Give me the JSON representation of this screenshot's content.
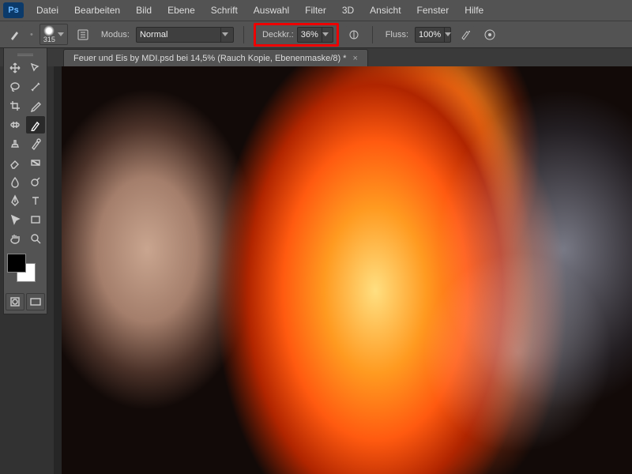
{
  "menubar": {
    "items": [
      "Datei",
      "Bearbeiten",
      "Bild",
      "Ebene",
      "Schrift",
      "Auswahl",
      "Filter",
      "3D",
      "Ansicht",
      "Fenster",
      "Hilfe"
    ]
  },
  "optbar": {
    "brush_size": "315",
    "mode_label": "Modus:",
    "mode_value": "Normal",
    "opacity_label": "Deckkr.:",
    "opacity_value": "36%",
    "flow_label": "Fluss:",
    "flow_value": "100%"
  },
  "tab": {
    "title": "Feuer und Eis by MDI.psd bei 14,5% (Rauch Kopie, Ebenenmaske/8) *",
    "close": "×"
  },
  "swatches": {
    "fg": "#000000",
    "bg": "#ffffff"
  }
}
